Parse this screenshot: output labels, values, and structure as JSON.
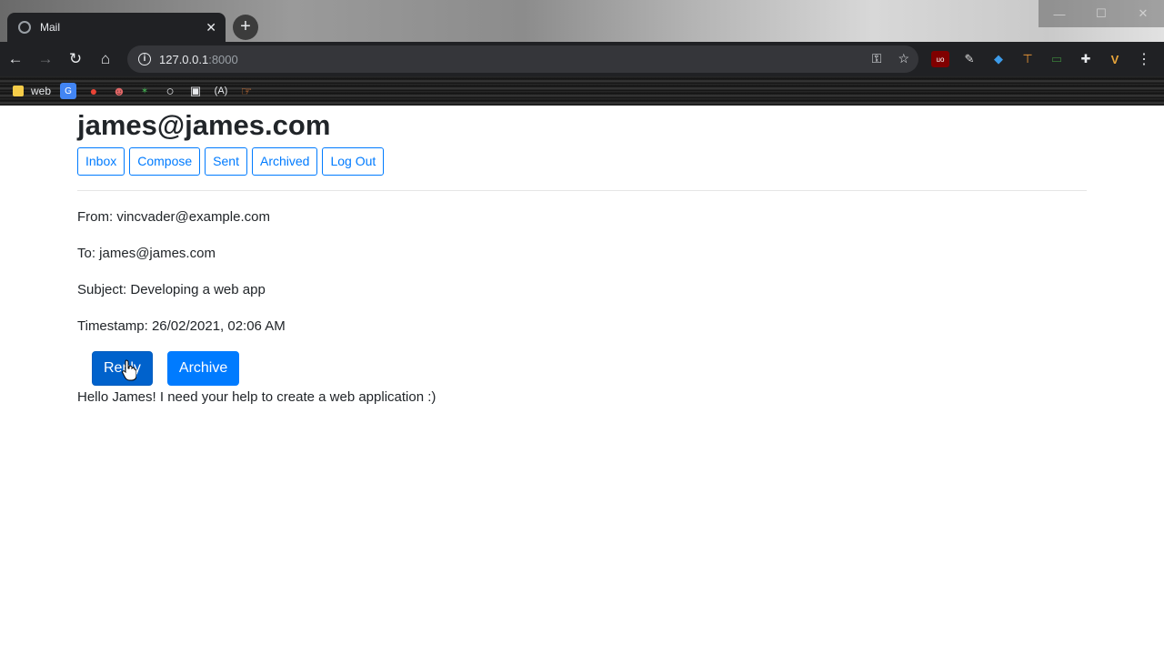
{
  "browser": {
    "tab": {
      "title": "Mail",
      "close_glyph": "✕"
    },
    "new_tab_glyph": "+",
    "window_controls": {
      "minimize": "—",
      "maximize": "☐",
      "close": "✕"
    },
    "nav": {
      "back": "←",
      "forward": "→",
      "reload": "↻",
      "home": "⌂"
    },
    "address": {
      "host": "127.0.0.1",
      "port": ":8000"
    },
    "omnibox_icons": {
      "key": "⚿",
      "star": "☆"
    },
    "extensions": [
      "ublock-icon",
      "extension-icon",
      "shield-icon",
      "pick-icon",
      "box-icon",
      "puzzle-icon",
      "profile-icon",
      "menu-icon"
    ],
    "menu_glyph": "⋮",
    "bookmarks": [
      {
        "label": "web",
        "icon": "folder-icon"
      }
    ]
  },
  "mail": {
    "user_email": "james@james.com",
    "nav_buttons": {
      "inbox": "Inbox",
      "compose": "Compose",
      "sent": "Sent",
      "archived": "Archived",
      "logout": "Log Out"
    },
    "email": {
      "from": "From: vincvader@example.com",
      "to": "To: james@james.com",
      "subject": "Subject: Developing a web app",
      "timestamp": "Timestamp: 26/02/2021, 02:06 AM",
      "body": "Hello James! I need your help to create a web application :)"
    },
    "actions": {
      "reply": "Reply",
      "archive": "Archive"
    }
  },
  "colors": {
    "primary": "#007bff",
    "primary_pressed": "#0062cc",
    "text": "#212529",
    "chrome_dark": "#202124"
  }
}
